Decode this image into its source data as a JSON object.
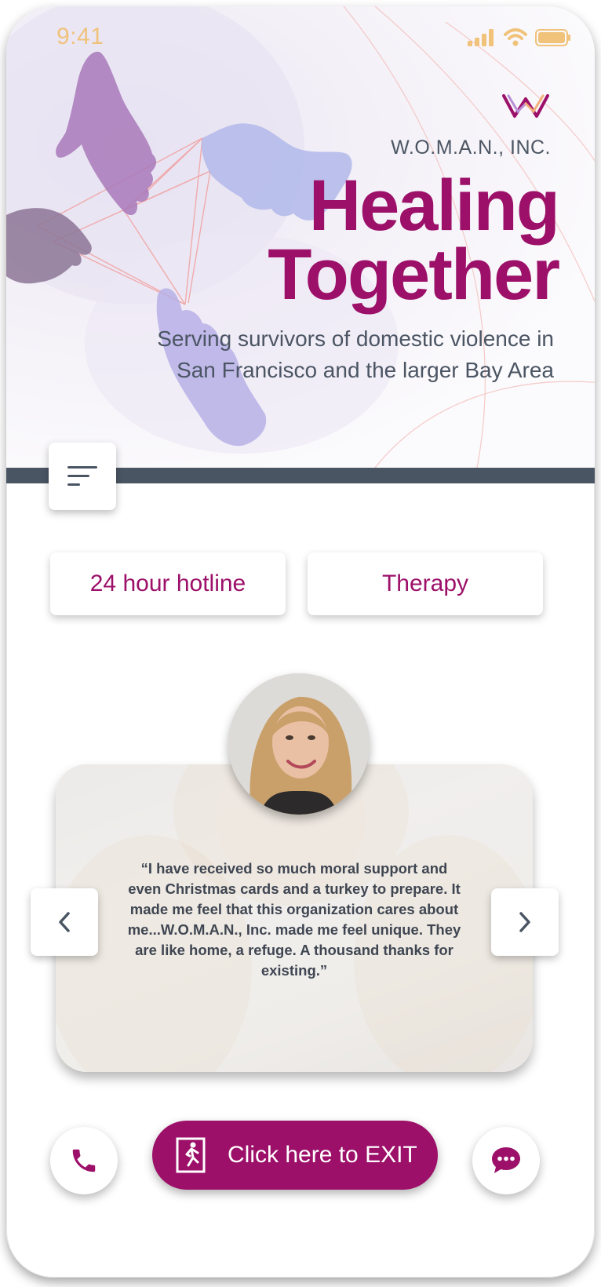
{
  "status_bar": {
    "time": "9:41"
  },
  "brand": {
    "name": "W.O.M.A.N., INC.",
    "logo_icon": "w-logo-icon"
  },
  "hero": {
    "title_line1": "Healing",
    "title_line2": "Together",
    "subtitle": "Serving survivors of domestic violence in San Francisco and the larger Bay Area"
  },
  "menu": {
    "icon": "menu-lines-icon"
  },
  "services": [
    {
      "label": "24 hour hotline"
    },
    {
      "label": "Therapy"
    }
  ],
  "testimonial": {
    "quote": "“I have received so much moral support and even Christmas cards and a turkey to prepare. It made me feel that this organization cares about me...W.O.M.A.N., Inc. made me feel unique. They are like home, a refuge. A thousand thanks for existing.”",
    "prev_icon": "chevron-left-icon",
    "next_icon": "chevron-right-icon"
  },
  "actions": {
    "exit_label": "Click here to EXIT",
    "exit_icon": "emergency-exit-icon",
    "call_icon": "phone-icon",
    "chat_icon": "chat-bubble-icon"
  },
  "colors": {
    "brand": "#9c1069",
    "text_gray": "#4b5563",
    "bar": "#4a5563",
    "status": "#f0c27a"
  }
}
